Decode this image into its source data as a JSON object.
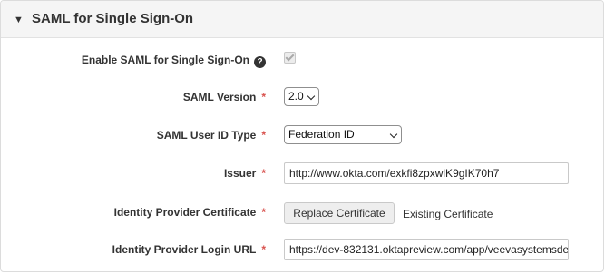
{
  "section": {
    "caret": "▼",
    "title": "SAML for Single Sign-On"
  },
  "fields": {
    "enable_saml": {
      "label": "Enable SAML for Single Sign-On",
      "help_icon": "question-circle-icon",
      "checked": true,
      "disabled": true
    },
    "saml_version": {
      "label": "SAML Version",
      "required_mark": "*",
      "value": "2.0"
    },
    "user_id_type": {
      "label": "SAML User ID Type",
      "required_mark": "*",
      "value": "Federation ID"
    },
    "issuer": {
      "label": "Issuer",
      "required_mark": "*",
      "value": "http://www.okta.com/exkfi8zpxwlK9gIK70h7"
    },
    "idp_certificate": {
      "label": "Identity Provider Certificate",
      "required_mark": "*",
      "button_label": "Replace Certificate",
      "status_text": "Existing Certificate"
    },
    "idp_login_url": {
      "label": "Identity Provider Login URL",
      "required_mark": "*",
      "value": "https://dev-832131.oktapreview.com/app/veevasystemsde"
    }
  },
  "colors": {
    "required": "#d9534f",
    "header_bg": "#f5f5f5"
  }
}
